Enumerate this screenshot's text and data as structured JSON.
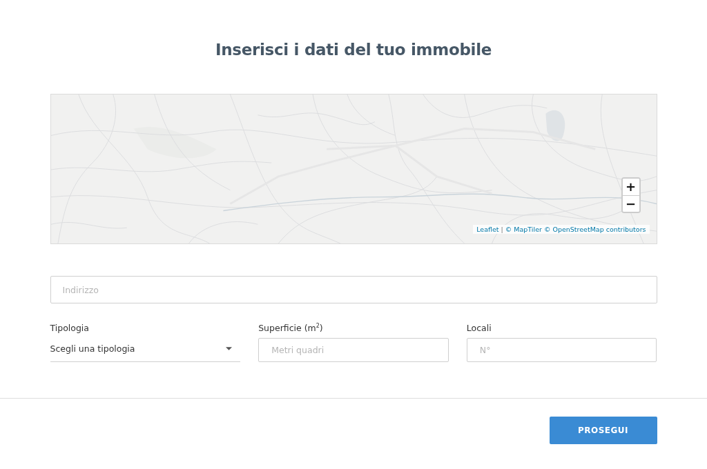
{
  "title": "Inserisci i dati del tuo immobile",
  "map": {
    "zoom_controls": [
      "+",
      "−"
    ],
    "attribution": [
      {
        "kind": "link",
        "text": "Leaflet"
      },
      {
        "kind": "separator",
        "text": "|"
      },
      {
        "kind": "link",
        "text": "© MapTiler"
      },
      {
        "kind": "link",
        "text": "© OpenStreetMap contributors"
      }
    ]
  },
  "address_field": {
    "placeholder": "Indirizzo"
  },
  "fields": [
    {
      "kind": "select",
      "label": "Tipologia",
      "value": "Scegli una tipologia"
    },
    {
      "kind": "input",
      "label": "Superficie (m$^{2}$)",
      "placeholder": "Metri quadri"
    },
    {
      "kind": "input",
      "label": "Locali",
      "placeholder": "N°"
    }
  ],
  "buttons": [
    {
      "label": "PROSEGUI"
    }
  ]
}
